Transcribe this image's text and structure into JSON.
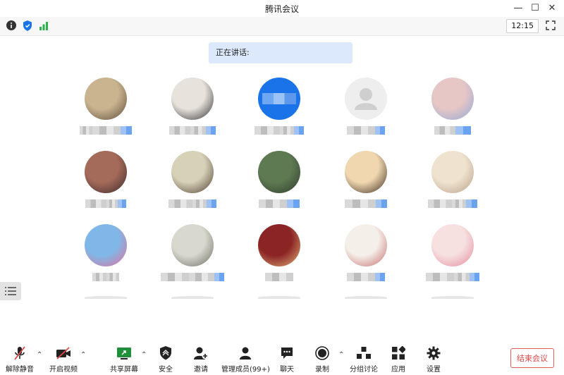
{
  "window": {
    "title": "腾讯会议"
  },
  "topbar": {
    "clock": "12:15"
  },
  "speaking": {
    "label": "正在讲话:"
  },
  "participants": [
    {
      "avatar_colors": [
        "#c9b48f",
        "#5b4a3a"
      ]
    },
    {
      "avatar_colors": [
        "#e8e2dc",
        "#2d2d2d"
      ]
    },
    {
      "avatar_colors": [
        "#1a73e8",
        "#1a73e8"
      ]
    },
    {
      "avatar_colors": [
        "#eeeeee",
        "#cfcfcf"
      ]
    },
    {
      "avatar_colors": [
        "#e7c6c6",
        "#8fa9d6"
      ]
    },
    {
      "avatar_colors": [
        "#a46a5a",
        "#3a2a2a"
      ]
    },
    {
      "avatar_colors": [
        "#d7d1b8",
        "#4b3b2d"
      ]
    },
    {
      "avatar_colors": [
        "#5e7a53",
        "#2f3a2a"
      ]
    },
    {
      "avatar_colors": [
        "#f0d7b0",
        "#3a2a1f"
      ]
    },
    {
      "avatar_colors": [
        "#efe3cf",
        "#b89f86"
      ]
    },
    {
      "avatar_colors": [
        "#7fb8e8",
        "#e56e9a"
      ]
    },
    {
      "avatar_colors": [
        "#d8d8cf",
        "#6c6c62"
      ]
    },
    {
      "avatar_colors": [
        "#8b2525",
        "#e4b37b"
      ]
    },
    {
      "avatar_colors": [
        "#f5efe9",
        "#c46b6b"
      ]
    },
    {
      "avatar_colors": [
        "#f6e0e0",
        "#e58b9a"
      ]
    }
  ],
  "bottombar": {
    "unmute": "解除静音",
    "start_video": "开启视频",
    "share_screen": "共享屏幕",
    "security": "安全",
    "invite": "邀请",
    "manage_members": "管理成员(99+)",
    "chat": "聊天",
    "record": "录制",
    "breakout": "分组讨论",
    "apps": "应用",
    "settings": "设置",
    "end_meeting": "结束会议"
  },
  "colors": {
    "accent": "#1a73e8",
    "end_red": "#e04848",
    "banner": "#dce8fb"
  }
}
